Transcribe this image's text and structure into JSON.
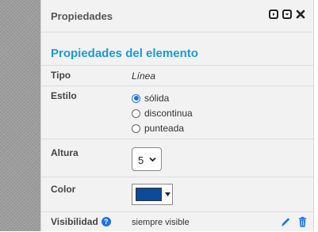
{
  "panel": {
    "title": "Propiedades",
    "section_title": "Propiedades del elemento"
  },
  "header_icons": [
    "expand-icon",
    "collapse-icon",
    "close-icon"
  ],
  "properties": {
    "tipo": {
      "label": "Tipo",
      "value": "Línea"
    },
    "estilo": {
      "label": "Estilo",
      "options": [
        {
          "label": "sólida",
          "checked": true
        },
        {
          "label": "discontinua",
          "checked": false
        },
        {
          "label": "punteada",
          "checked": false
        }
      ]
    },
    "altura": {
      "label": "Altura",
      "value": "5"
    },
    "color": {
      "label": "Color",
      "value": "#0e4a9a"
    },
    "visibilidad": {
      "label": "Visibilidad",
      "value": "siempre visible"
    }
  },
  "colors": {
    "accent": "#1a9bd7",
    "radio": "#1a73e8",
    "icon": "#1a73e8"
  }
}
